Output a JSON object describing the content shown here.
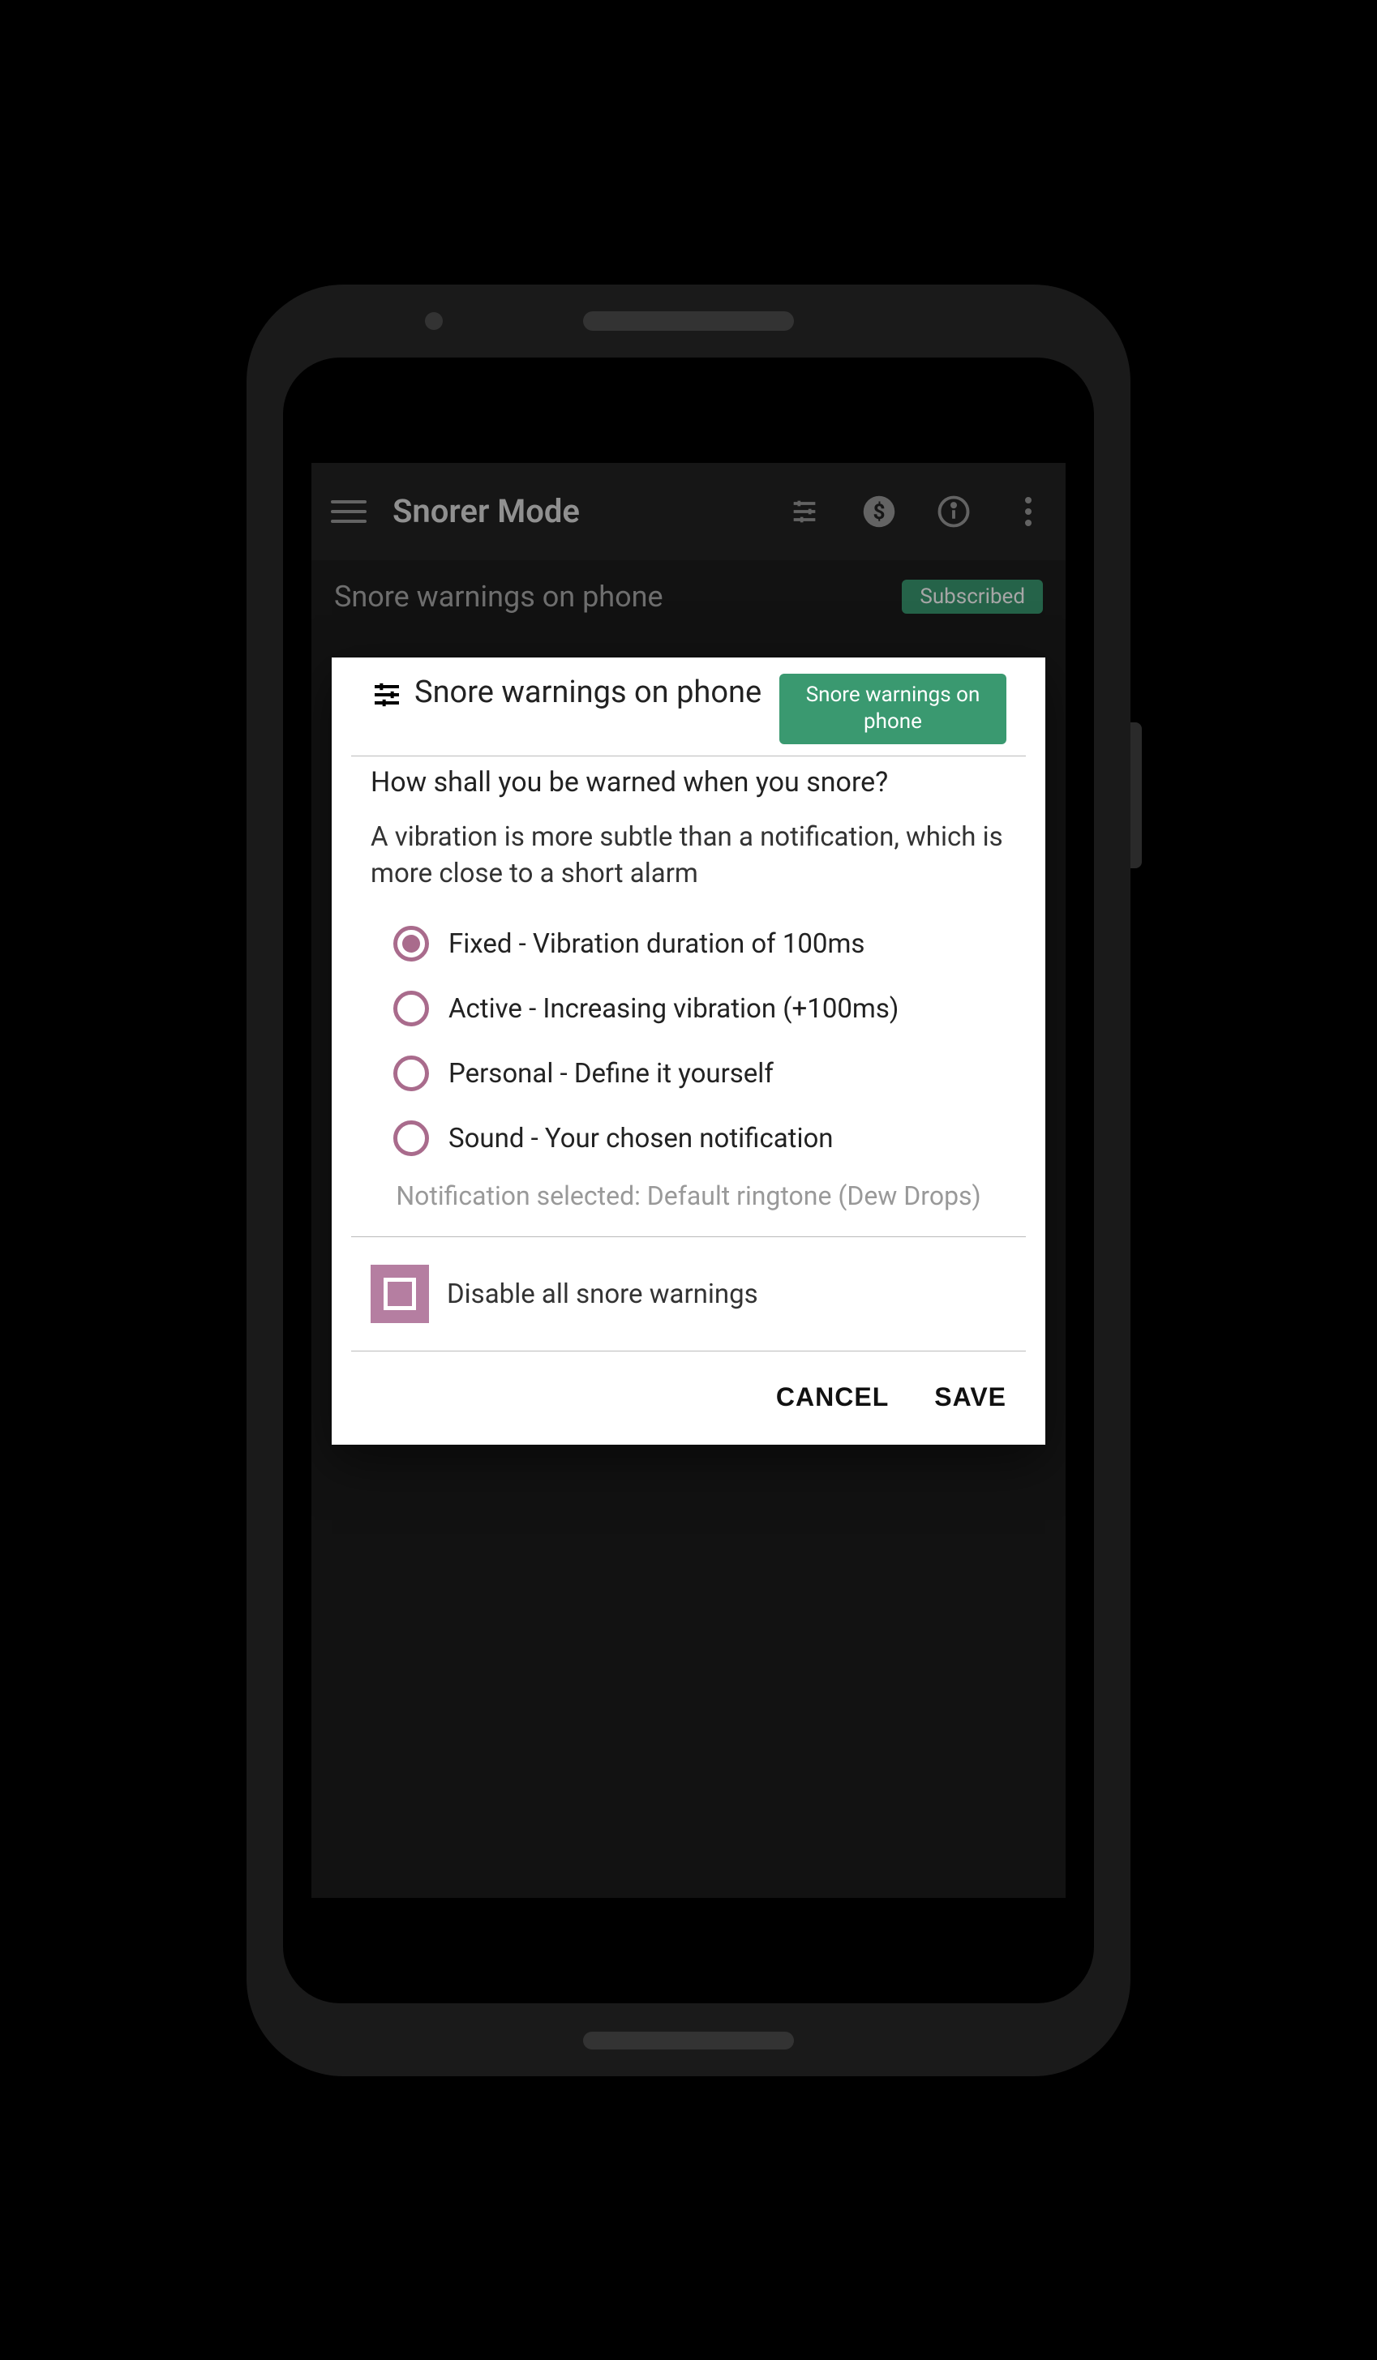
{
  "appbar": {
    "title": "Snorer Mode"
  },
  "background": {
    "title": "Snore warnings on phone",
    "badge": "Subscribed"
  },
  "dialog": {
    "title": "Snore warnings on phone",
    "badge": "Snore warnings on phone",
    "question": "How shall you be warned when you snore?",
    "description": "A vibration is more subtle than a notification, which is more close to a short alarm",
    "options": [
      {
        "label": "Fixed - Vibration duration of 100ms",
        "selected": true
      },
      {
        "label": "Active - Increasing vibration (+100ms)",
        "selected": false
      },
      {
        "label": "Personal - Define it yourself",
        "selected": false
      },
      {
        "label": "Sound - Your chosen notification",
        "selected": false
      }
    ],
    "note": "Notification selected: Default ringtone (Dew Drops)",
    "checkbox_label": "Disable all snore warnings",
    "actions": {
      "cancel": "CANCEL",
      "save": "SAVE"
    }
  }
}
